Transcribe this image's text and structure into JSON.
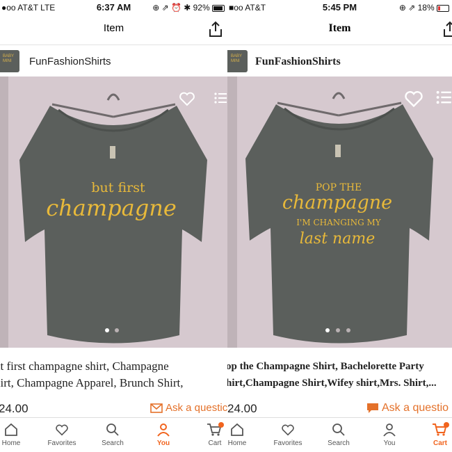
{
  "panels": [
    {
      "status": {
        "carrier": "●oo AT&T  LTE",
        "time": "6:37 AM",
        "right": "⊕ ⇗ ⏰ ✱ 92%"
      },
      "nav": {
        "title": "Item"
      },
      "shop": {
        "name": "FunFashionShirts"
      },
      "product": {
        "print_lines": [
          "but first",
          "champagne"
        ],
        "title_lines": [
          "ut first champagne shirt, Champagne",
          "hirt, Champagne Apparel, Brunch Shirt,"
        ],
        "price": "24.00",
        "ask": "Ask a questic",
        "image_count": 2,
        "image_active": 0
      },
      "tabs": [
        {
          "label": "Home",
          "icon": "home-icon"
        },
        {
          "label": "Favorites",
          "icon": "heart-icon"
        },
        {
          "label": "Search",
          "icon": "search-icon"
        },
        {
          "label": "You",
          "icon": "person-icon"
        },
        {
          "label": "Cart",
          "icon": "cart-icon"
        }
      ],
      "active_tab": "You"
    },
    {
      "status": {
        "carrier": "■oo AT&T",
        "time": "5:45 PM",
        "right": "⊕ ⇗ 18%"
      },
      "nav": {
        "title": "Item"
      },
      "shop": {
        "name": "FunFashionShirts"
      },
      "product": {
        "print_lines": [
          "POP THE",
          "champagne",
          "I'M CHANGING MY",
          "last name"
        ],
        "title_lines": [
          "op the Champagne Shirt,  Bachelorette Party",
          "hirt,Champagne Shirt,Wifey shirt,Mrs. Shirt,..."
        ],
        "price": "24.00",
        "ask": "Ask a questio",
        "image_count": 3,
        "image_active": 0
      },
      "tabs": [
        {
          "label": "Home",
          "icon": "home-icon"
        },
        {
          "label": "Favorites",
          "icon": "heart-icon"
        },
        {
          "label": "Search",
          "icon": "search-icon"
        },
        {
          "label": "You",
          "icon": "person-icon"
        },
        {
          "label": "Cart",
          "icon": "cart-icon"
        }
      ],
      "active_tab": "Cart"
    }
  ],
  "colors": {
    "accent": "#f1641e",
    "shirt": "#5b5f5c",
    "print": "#e8b93a",
    "photo_bg": "#d6c9cf"
  }
}
